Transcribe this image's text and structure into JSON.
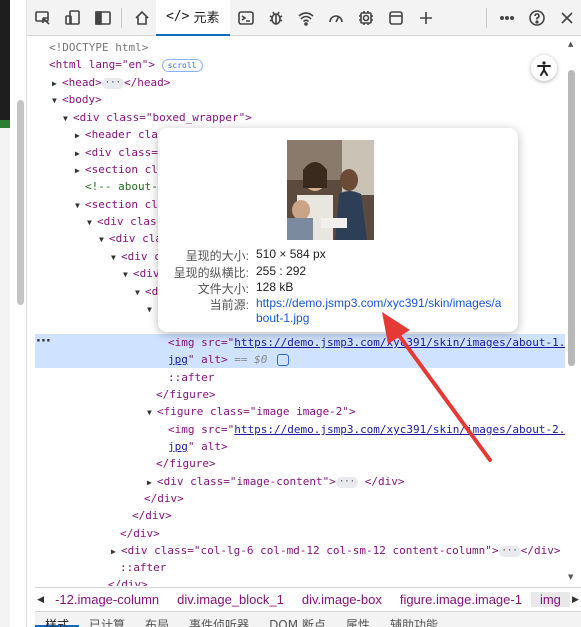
{
  "toolbar": {
    "elements_tab": "元素",
    "icons": [
      "inspect-icon",
      "device-toggle-icon",
      "sidebar-icon",
      "home-icon",
      "console-icon",
      "debugger-icon",
      "network-icon",
      "performance-icon",
      "settings-icon",
      "application-icon",
      "add-tab-icon",
      "more-icon",
      "help-icon",
      "close-icon"
    ]
  },
  "dom": {
    "doctype": "<!DOCTYPE html>",
    "html_open": "<html lang=\"en\">",
    "scroll_badge": "scroll",
    "head": "<head>",
    "head_close": "</head>",
    "body": "<body>",
    "div_boxed": "<div class=\"boxed_wrapper\">",
    "header_partial": "<header cla",
    "div_partial": "<div class=",
    "section_partial": "<section cl",
    "comment_partial": "<!-- about-",
    "section2_partial": "<section cl",
    "div_clas1": "<div clas",
    "div_cla": "<div cla",
    "div_c": "<div c",
    "div_div": "<div",
    "d": "<d",
    "img1_src_prefix": "<img src=\"",
    "img1_url": "https://demo.jsmp3.com/xyc391/skin/images/about-1.",
    "img1_line2": "jpg",
    "img1_alt": "\" alt>",
    "img1_dollar": " == $0",
    "after1": "::after",
    "figure_close": "</figure>",
    "figure2_open": "<figure class=\"image image-2\">",
    "img2_src_prefix": "<img src=\"",
    "img2_url": "https://demo.jsmp3.com/xyc391/skin/images/about-2.",
    "img2_line2": "jpg",
    "img2_alt": "\" alt>",
    "figure2_close": "</figure>",
    "div_image_content": "<div class=\"image-content\">",
    "div_close_after_ic": "</div>",
    "div_close_a": "</div>",
    "div_close_b": "</div>",
    "div_close_c": "</div>",
    "div_col": "<div class=\"col-lg-6 col-md-12 col-sm-12 content-column\">",
    "div_col_close": "</div>",
    "after2": "::after",
    "div_close_last": "</div>"
  },
  "popup": {
    "rendered_size_label": "呈现的大小:",
    "rendered_size_value": "510 × 584 px",
    "aspect_label": "呈现的纵横比:",
    "aspect_value": "255 : 292",
    "file_size_label": "文件大小:",
    "file_size_value": "128 kB",
    "current_src_label": "当前源:",
    "current_src_value": "https://demo.jsmp3.com/xyc391/skin/images/about-1.jpg"
  },
  "breadcrumb": {
    "items": [
      "-12.image-column",
      "div.image_block_1",
      "div.image-box",
      "figure.image.image-1",
      "img"
    ]
  },
  "bottom_tabs": [
    "样式",
    "已计算",
    "布局",
    "事件侦听器",
    "DOM 断点",
    "属性",
    "辅助功能"
  ],
  "colors": {
    "tag": "#881280",
    "attr": "#994500",
    "value": "#1a1aa6",
    "selected_row": "#cfe2ff",
    "arrow": "#e53935",
    "accent": "#0f6cbd"
  }
}
